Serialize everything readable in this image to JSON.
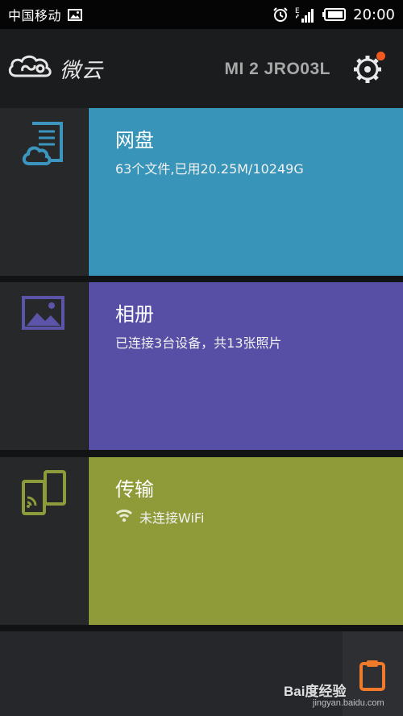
{
  "status_bar": {
    "carrier": "中国移动",
    "time": "20:00",
    "network_label": "E",
    "icons": [
      "image-icon",
      "alarm-icon",
      "signal-icon",
      "battery-icon"
    ]
  },
  "header": {
    "app_name": "微云",
    "device_name": "MI 2 JRO03L",
    "icons": [
      "cloud-logo-icon",
      "gear-icon"
    ]
  },
  "rows": [
    {
      "title": "网盘",
      "subtitle": "63个文件,已用20.25M/10249G",
      "color": "#3894b8",
      "icon": "cloud-document-icon",
      "icon_color": "#3b95be"
    },
    {
      "title": "相册",
      "subtitle": "已连接3台设备，共13张照片",
      "color": "#574fa6",
      "icon": "picture-icon",
      "icon_color": "#5b54a8"
    },
    {
      "title": "传输",
      "subtitle": "未连接WiFi",
      "color": "#8f9a38",
      "icon": "phone-transfer-icon",
      "icon_color": "#8e9b3a",
      "subtitle_icon": "wifi-icon"
    }
  ],
  "bottom_bar": {
    "icon": "clipboard-icon",
    "icon_color": "#f07a2c"
  },
  "watermark": {
    "text": "Bai度经验",
    "sub": "jingyan.baidu.com"
  }
}
